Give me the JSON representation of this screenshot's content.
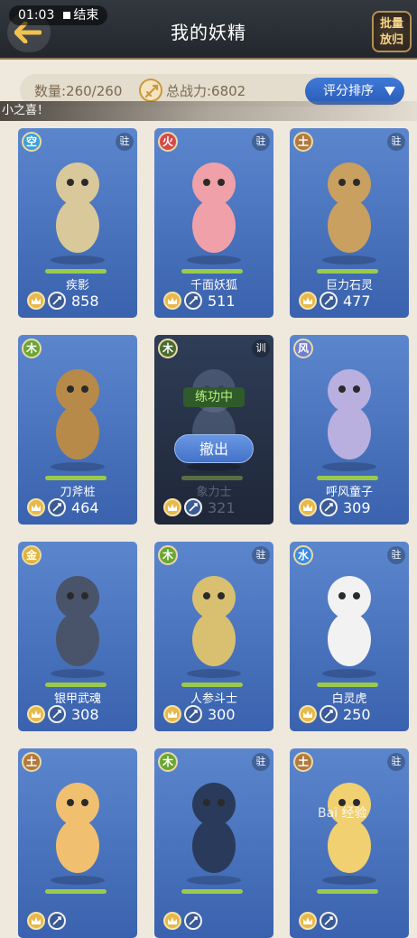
{
  "status": {
    "time": "01:03",
    "end_label": "结束"
  },
  "header": {
    "title": "我的妖精",
    "batch_label_1": "批量",
    "batch_label_2": "放归"
  },
  "stats": {
    "count": "数量:260/260",
    "power": "总战力:6802"
  },
  "sort": {
    "label": "评分排序"
  },
  "marquee": {
    "text": "小之喜！"
  },
  "watermark": {
    "text": "Bai 经验"
  },
  "cards": [
    {
      "element": "空",
      "element_color": "#3aa0d8",
      "badge": "驻",
      "name": "疾影",
      "score": "858",
      "dark": false
    },
    {
      "element": "火",
      "element_color": "#d64a4a",
      "badge": "驻",
      "name": "千面妖狐",
      "score": "511",
      "dark": false
    },
    {
      "element": "土",
      "element_color": "#b27a3e",
      "badge": "驻",
      "name": "巨力石灵",
      "score": "477",
      "dark": false
    },
    {
      "element": "木",
      "element_color": "#6aa632",
      "badge": "",
      "name": "刀斧桩",
      "score": "464",
      "dark": false
    },
    {
      "element": "木",
      "element_color": "#4a6a2e",
      "badge": "训",
      "name": "象力士",
      "score": "321",
      "dark": true,
      "train_label": "练功中",
      "withdraw_label": "撤出"
    },
    {
      "element": "风",
      "element_color": "#6f7fd0",
      "badge": "",
      "name": "呼风童子",
      "score": "309",
      "dark": false
    },
    {
      "element": "金",
      "element_color": "#e0b43a",
      "badge": "",
      "name": "银甲武魂",
      "score": "308",
      "dark": false
    },
    {
      "element": "木",
      "element_color": "#6aa632",
      "badge": "驻",
      "name": "人参斗士",
      "score": "300",
      "dark": false
    },
    {
      "element": "水",
      "element_color": "#3a8ae0",
      "badge": "驻",
      "name": "白灵虎",
      "score": "250",
      "dark": false
    },
    {
      "element": "土",
      "element_color": "#b27a3e",
      "badge": "",
      "name": "",
      "score": "",
      "dark": false
    },
    {
      "element": "木",
      "element_color": "#6aa632",
      "badge": "驻",
      "name": "",
      "score": "",
      "dark": false
    },
    {
      "element": "土",
      "element_color": "#b27a3e",
      "badge": "驻",
      "name": "",
      "score": "",
      "dark": false
    }
  ]
}
